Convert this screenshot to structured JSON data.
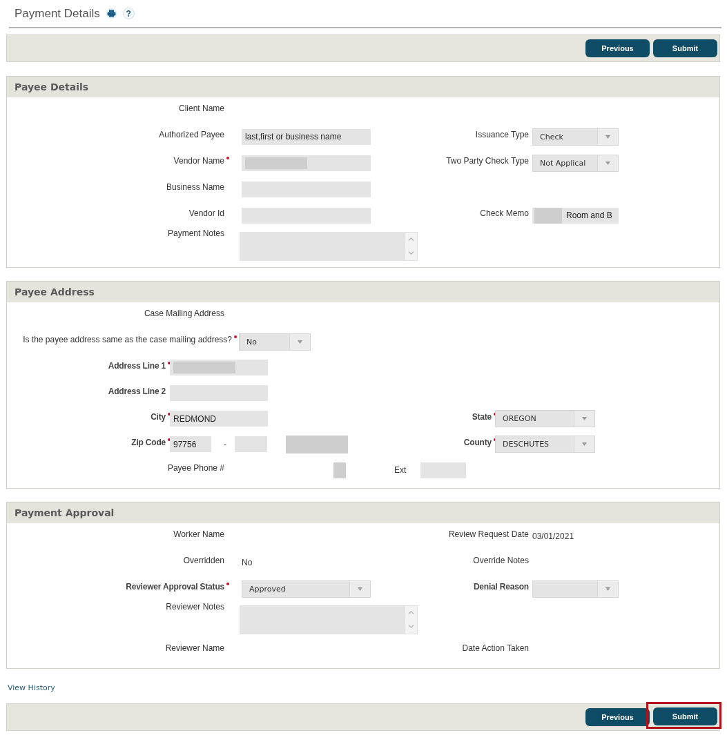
{
  "page": {
    "title": "Payment Details",
    "help": "?"
  },
  "top_toolbar": {
    "buttons": [
      {
        "label": "Previous",
        "highlighted": false
      },
      {
        "label": "Submit",
        "highlighted": false
      }
    ]
  },
  "sections": [
    {
      "title": "Payee Details",
      "rows": [
        {
          "kind": "standard",
          "left": {
            "label": "Client Name"
          }
        },
        {
          "kind": "standard",
          "left": {
            "label": "Authorized Payee",
            "field": {
              "kind": "input",
              "value": "last,first or business name"
            }
          },
          "right": {
            "label": "Issuance Type",
            "field": {
              "kind": "select",
              "value": "Check"
            }
          }
        },
        {
          "kind": "standard",
          "left": {
            "label": "Vendor Name",
            "required": true,
            "field": {
              "kind": "input",
              "redacted": true
            }
          },
          "right": {
            "label": "Two Party Check Type",
            "field": {
              "kind": "select",
              "value": "Not Applical"
            }
          }
        },
        {
          "kind": "standard",
          "left": {
            "label": "Business Name",
            "field": {
              "kind": "input"
            }
          }
        },
        {
          "kind": "standard",
          "left": {
            "label": "Vendor Id",
            "field": {
              "kind": "input"
            }
          },
          "right": {
            "label": "Check Memo",
            "field": {
              "kind": "input",
              "redacted": true,
              "value": "Room and B"
            }
          }
        },
        {
          "kind": "standard",
          "left": {
            "label": "Payment Notes",
            "field": {
              "kind": "textarea"
            }
          }
        }
      ]
    },
    {
      "title": "Payee Address",
      "rows": [
        {
          "kind": "standard",
          "left": {
            "label": "Case Mailing Address"
          }
        },
        {
          "kind": "question",
          "left": {
            "label": "Is the payee address same as the case mailing address?",
            "required": true,
            "field": {
              "kind": "select",
              "value": "No"
            }
          }
        },
        {
          "kind": "compact",
          "left": {
            "label": "Address Line 1",
            "required": true,
            "emphasis": true,
            "field": {
              "kind": "input",
              "redacted": true
            }
          }
        },
        {
          "kind": "compact",
          "left": {
            "label": "Address Line 2",
            "emphasis": true,
            "field": {
              "kind": "input"
            }
          }
        },
        {
          "kind": "compact",
          "left": {
            "label": "City",
            "required": true,
            "emphasis": true,
            "field": {
              "kind": "input",
              "value": "REDMOND"
            }
          },
          "right": {
            "label": "State",
            "required": true,
            "emphasis": true,
            "field": {
              "kind": "select",
              "value": "OREGON"
            }
          }
        },
        {
          "kind": "zip",
          "left": {
            "label": "Zip Code",
            "required": true,
            "emphasis": true,
            "field": {
              "kind": "group",
              "parts": [
                {
                  "kind": "input",
                  "value": "97756"
                },
                {
                  "kind": "separator",
                  "text": "-"
                },
                {
                  "kind": "input"
                },
                {
                  "kind": "redaction"
                }
              ]
            }
          },
          "right": {
            "label": "County",
            "required": true,
            "emphasis": true,
            "field": {
              "kind": "select",
              "value": "DESCHUTES"
            }
          }
        },
        {
          "kind": "phone",
          "left": {
            "label": "Payee Phone #",
            "field": {
              "kind": "group",
              "parts": [
                {
                  "kind": "redaction"
                },
                {
                  "kind": "label",
                  "text": "Ext"
                },
                {
                  "kind": "input"
                }
              ]
            }
          }
        }
      ]
    },
    {
      "title": "Payment Approval",
      "rows": [
        {
          "kind": "standard",
          "left": {
            "label": "Worker Name"
          },
          "right": {
            "label": "Review Request Date",
            "field": {
              "kind": "value",
              "value": "03/01/2021"
            }
          }
        },
        {
          "kind": "standard",
          "left": {
            "label": "Overridden",
            "field": {
              "kind": "value",
              "value": "No"
            }
          },
          "right": {
            "label": "Override Notes"
          }
        },
        {
          "kind": "standard",
          "left": {
            "label": "Reviewer Approval Status",
            "required": true,
            "emphasis": true,
            "field": {
              "kind": "select",
              "value": "Approved"
            }
          },
          "right": {
            "label": "Denial Reason",
            "emphasis": true,
            "field": {
              "kind": "select"
            }
          }
        },
        {
          "kind": "standard",
          "left": {
            "label": "Reviewer Notes",
            "field": {
              "kind": "textarea"
            }
          }
        },
        {
          "kind": "standard",
          "left": {
            "label": "Reviewer Name"
          },
          "right": {
            "label": "Date Action Taken"
          }
        }
      ]
    }
  ],
  "link": "View History",
  "bottom_toolbar": {
    "buttons": [
      {
        "label": "Previous",
        "highlighted": false
      },
      {
        "label": "Submit",
        "highlighted": true
      }
    ]
  }
}
